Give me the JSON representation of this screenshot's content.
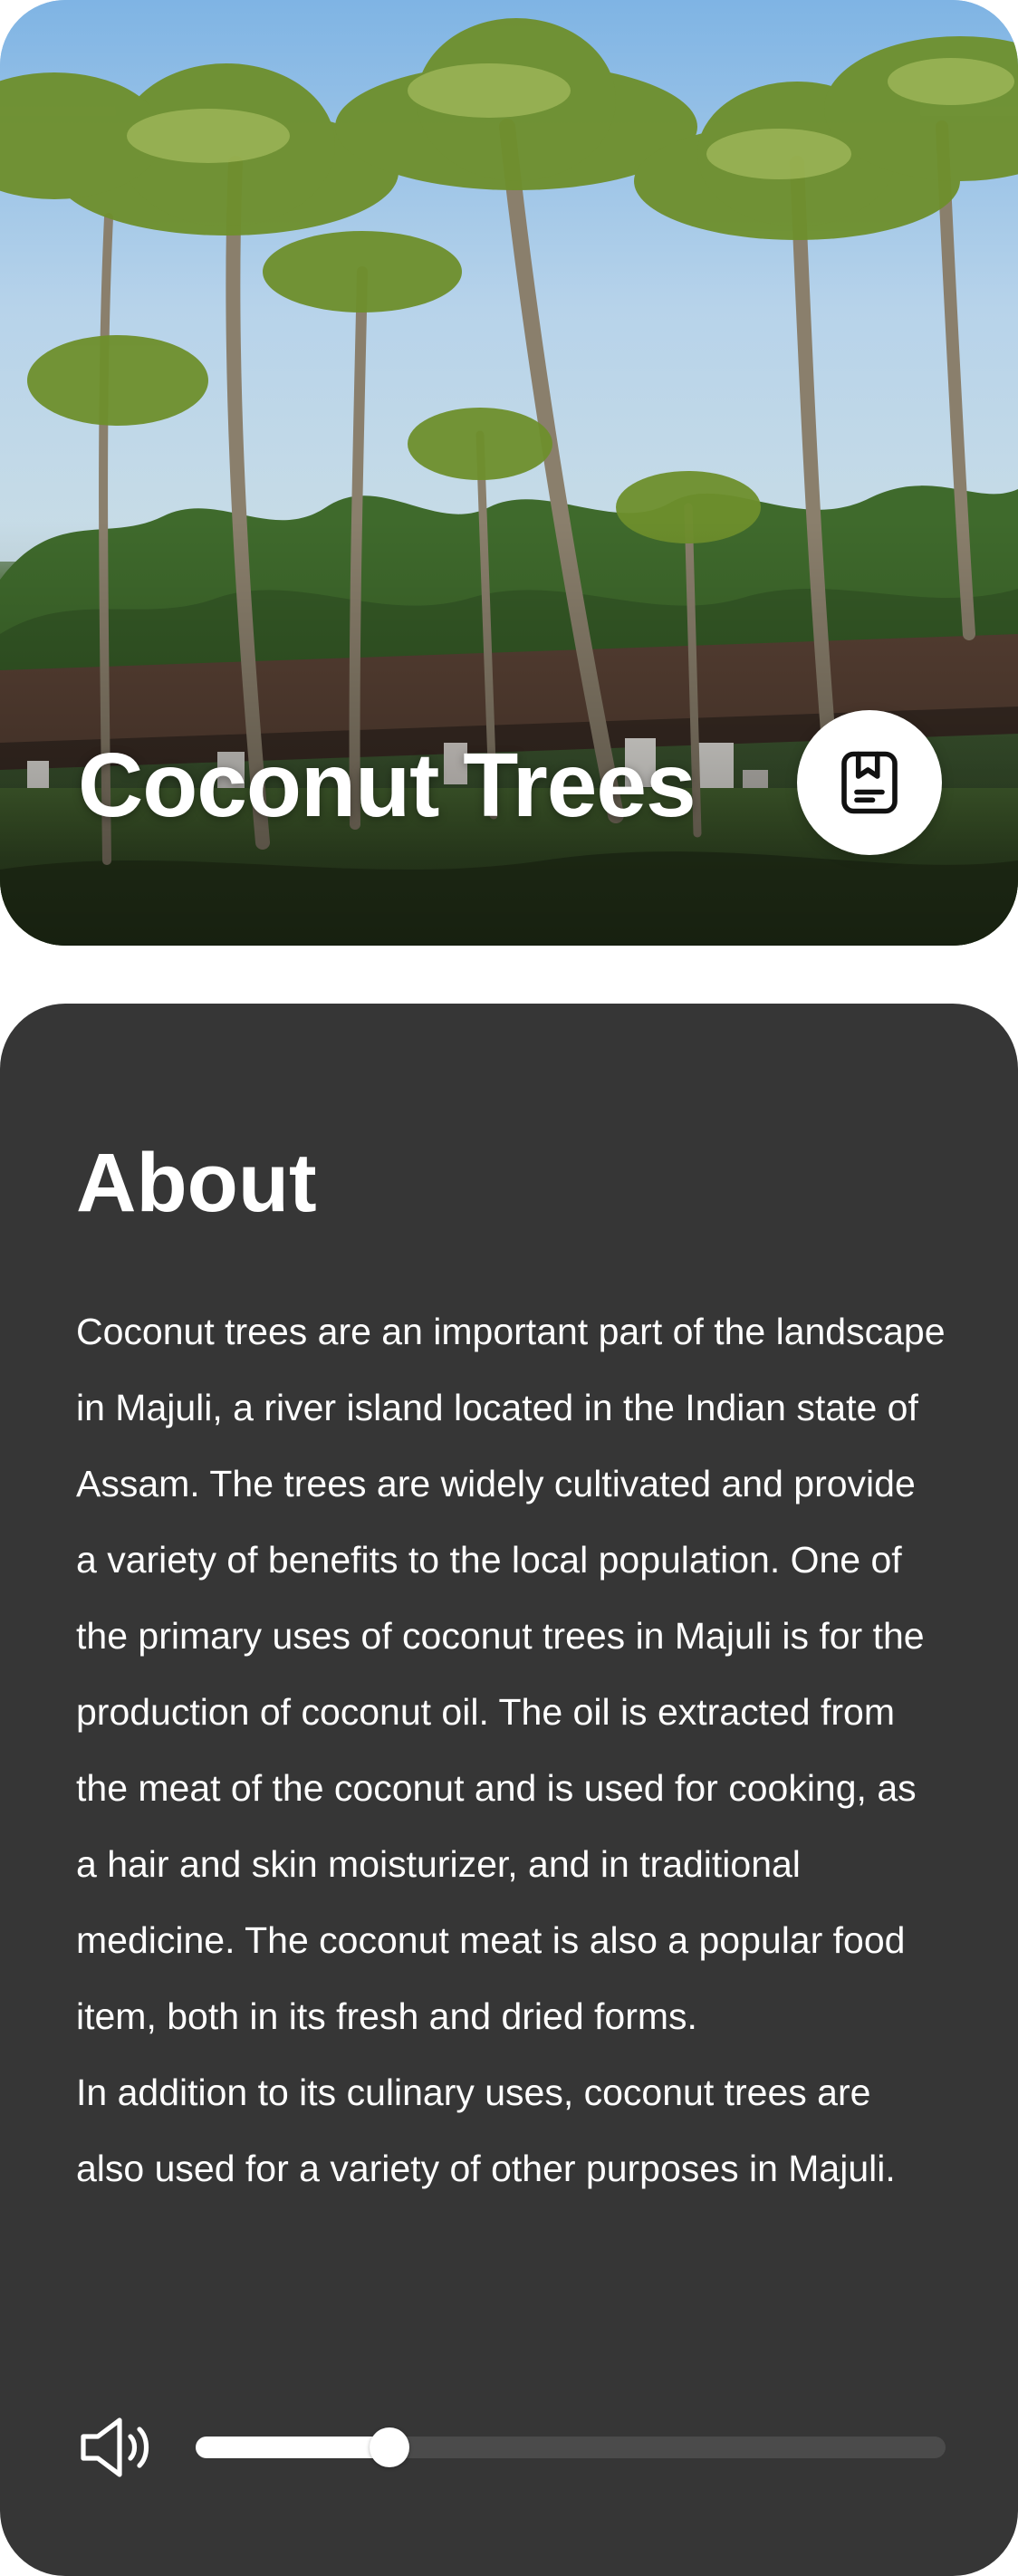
{
  "hero": {
    "title": "Coconut Trees",
    "bookmark_icon": "bookmark-icon"
  },
  "about": {
    "heading": "About",
    "paragraphs": [
      "Coconut trees are an important part of the landscape in Majuli, a river island located in the Indian state of Assam. The trees are widely cultivated and provide a variety of benefits to the local population. One of the primary uses of coconut trees in Majuli is for the production of coconut oil. The oil is extracted from the meat of the coconut and is used for cooking, as a hair and skin moisturizer, and in traditional medicine. The coconut meat is also a popular food item, both in its fresh and dried forms.",
      "In addition to its culinary uses, coconut trees are also used for a variety of other purposes in Majuli."
    ]
  },
  "audio": {
    "speaker_icon": "speaker-volume-icon",
    "progress_fraction": 0.258
  },
  "colors": {
    "card_background": "#363636",
    "text": "#ffffff",
    "track": "#4b4b4b",
    "fill": "#ffffff"
  }
}
